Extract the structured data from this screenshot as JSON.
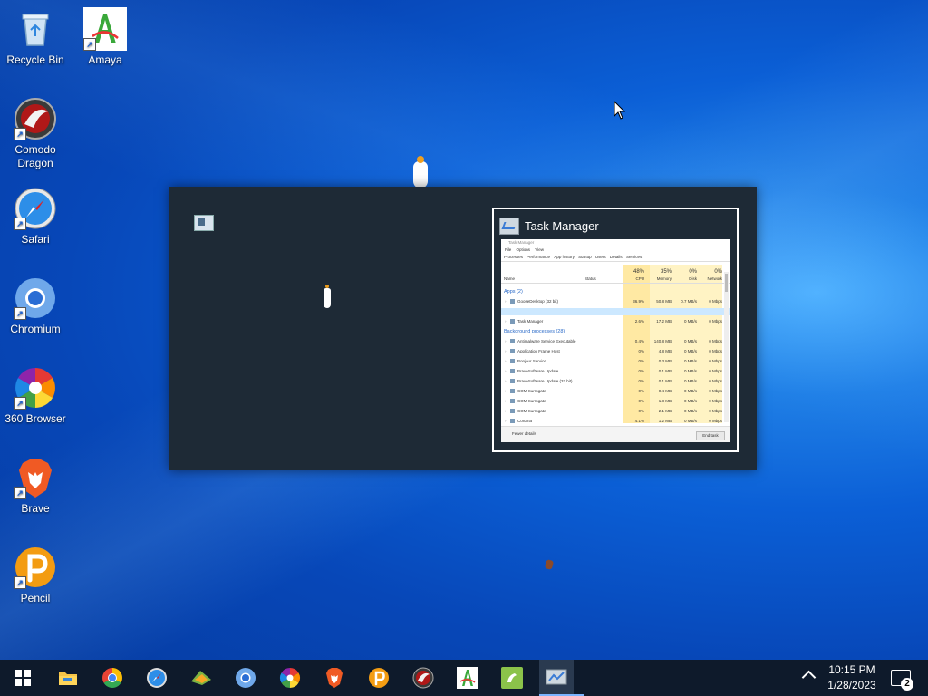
{
  "desktop_icons": [
    {
      "label": "Recycle Bin",
      "icon": "recycle-bin-icon"
    },
    {
      "label": "Amaya",
      "icon": "amaya-icon"
    },
    {
      "label": "Comodo Dragon",
      "icon": "comodo-dragon-icon"
    },
    {
      "label": "Safari",
      "icon": "safari-icon"
    },
    {
      "label": "Chromium",
      "icon": "chromium-icon"
    },
    {
      "label": "360 Browser",
      "icon": "360-browser-icon"
    },
    {
      "label": "Brave",
      "icon": "brave-icon"
    },
    {
      "label": "Pencil",
      "icon": "pencil-icon"
    }
  ],
  "switcher": {
    "window_title": "Task Manager"
  },
  "task_manager_thumbnail": {
    "title": "Task Manager",
    "menu": [
      "File",
      "Options",
      "View"
    ],
    "tabs": [
      "Processes",
      "Performance",
      "App history",
      "Startup",
      "Users",
      "Details",
      "Services"
    ],
    "header": {
      "cpu_pct": "48%",
      "mem_pct": "35%",
      "disk_pct": "0%",
      "net_pct": "0%",
      "name": "Name",
      "status": "Status",
      "cpu": "CPU",
      "memory": "Memory",
      "disk": "Disk",
      "network": "Network"
    },
    "apps_group": "Apps (2)",
    "bg_group": "Background processes (28)",
    "rows": [
      {
        "name": "GooseDesktop (32 bit)",
        "cpu": "36.9%",
        "mem": "50.8 MB",
        "disk": "0.7 MB/s",
        "net": "0 Mbps"
      },
      {
        "name": "Task Manager",
        "cpu": "2.6%",
        "mem": "17.2 MB",
        "disk": "0 MB/s",
        "net": "0 Mbps"
      },
      {
        "name": "Antimalware Service Executable",
        "cpu": "0.4%",
        "mem": "140.8 MB",
        "disk": "0 MB/s",
        "net": "0 Mbps"
      },
      {
        "name": "Application Frame Host",
        "cpu": "0%",
        "mem": "4.8 MB",
        "disk": "0 MB/s",
        "net": "0 Mbps"
      },
      {
        "name": "Bonjour Service",
        "cpu": "0%",
        "mem": "0.3 MB",
        "disk": "0 MB/s",
        "net": "0 Mbps"
      },
      {
        "name": "BraveSoftware Update",
        "cpu": "0%",
        "mem": "0.1 MB",
        "disk": "0 MB/s",
        "net": "0 Mbps"
      },
      {
        "name": "BraveSoftware Update (32 bit)",
        "cpu": "0%",
        "mem": "0.1 MB",
        "disk": "0 MB/s",
        "net": "0 Mbps"
      },
      {
        "name": "COM Surrogate",
        "cpu": "0%",
        "mem": "0.4 MB",
        "disk": "0 MB/s",
        "net": "0 Mbps"
      },
      {
        "name": "COM Surrogate",
        "cpu": "0%",
        "mem": "1.8 MB",
        "disk": "0 MB/s",
        "net": "0 Mbps"
      },
      {
        "name": "COM Surrogate",
        "cpu": "0%",
        "mem": "2.1 MB",
        "disk": "0 MB/s",
        "net": "0 Mbps"
      },
      {
        "name": "Cortana",
        "cpu": "4.1%",
        "mem": "1.2 MB",
        "disk": "0 MB/s",
        "net": "0 Mbps"
      }
    ],
    "footer_left": "Fewer details",
    "end_task": "End task"
  },
  "taskbar": {
    "items": [
      "start-icon",
      "file-explorer-icon",
      "chrome-icon",
      "safari-icon",
      "pidgin-icon",
      "chromium-icon",
      "360-browser-icon",
      "brave-icon",
      "pencil-icon",
      "comodo-dragon-icon",
      "amaya-icon",
      "goose-desktop-icon",
      "task-manager-icon"
    ],
    "time": "10:15 PM",
    "date": "1/28/2023",
    "notification_count": "2"
  }
}
